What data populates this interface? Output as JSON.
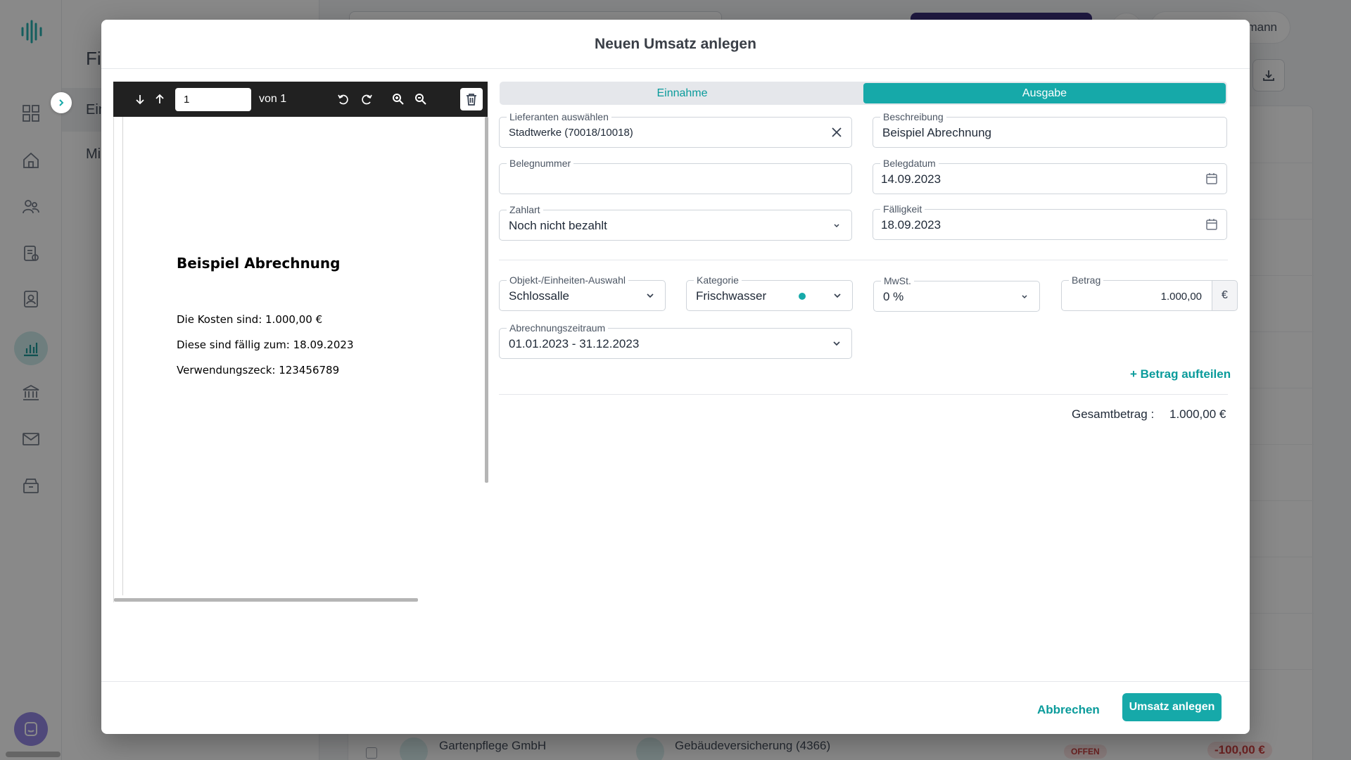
{
  "background": {
    "subnav": {
      "title": "Fi",
      "items": [
        "Ein",
        "Mi"
      ]
    },
    "user": {
      "name": "mann"
    },
    "last_row": {
      "name": "Gartenpflege GmbH",
      "category": "Gebäudeversicherung (4366)",
      "status": "OFFEN",
      "amount": "-100,00 €"
    }
  },
  "modal": {
    "title": "Neuen Umsatz anlegen",
    "viewer": {
      "page_value": "1",
      "page_count": "von 1",
      "document": {
        "title": "Beispiel Abrechnung",
        "lines": [
          "Die Kosten sind: 1.000,00 €",
          "Diese sind fällig zum: 18.09.2023",
          "Verwendungszeck: 123456789"
        ]
      }
    },
    "type_toggle": {
      "income": "Einnahme",
      "expense": "Ausgabe",
      "selected": "Ausgabe"
    },
    "fields": {
      "supplier": {
        "label": "Lieferanten auswählen",
        "value": "Stadtwerke (70018/10018)"
      },
      "description": {
        "label": "Beschreibung",
        "value": "Beispiel Abrechnung"
      },
      "receipt_number": {
        "label": "Belegnummer",
        "value": ""
      },
      "receipt_date": {
        "label": "Belegdatum",
        "value": "14.09.2023"
      },
      "payment_method": {
        "label": "Zahlart",
        "value": "Noch nicht bezahlt"
      },
      "due_date": {
        "label": "Fälligkeit",
        "value": "18.09.2023"
      },
      "object": {
        "label": "Objekt-/Einheiten-Auswahl",
        "value": "Schlossalle"
      },
      "category": {
        "label": "Kategorie",
        "value": "Frischwasser"
      },
      "vat": {
        "label": "MwSt.",
        "value": "0 %"
      },
      "amount": {
        "label": "Betrag",
        "value": "1.000,00",
        "currency": "€"
      },
      "billing_period": {
        "label": "Abrechnungszeitraum",
        "value": "01.01.2023 - 31.12.2023"
      }
    },
    "split_link": "+ Betrag aufteilen",
    "total": {
      "label": "Gesamtbetrag :",
      "value": "1.000,00 €"
    },
    "buttons": {
      "cancel": "Abbrechen",
      "submit": "Umsatz anlegen"
    }
  },
  "colors": {
    "accent": "#16a9a9",
    "accent_text": "#0a9b9b",
    "viewer_toolbar": "#212121"
  }
}
